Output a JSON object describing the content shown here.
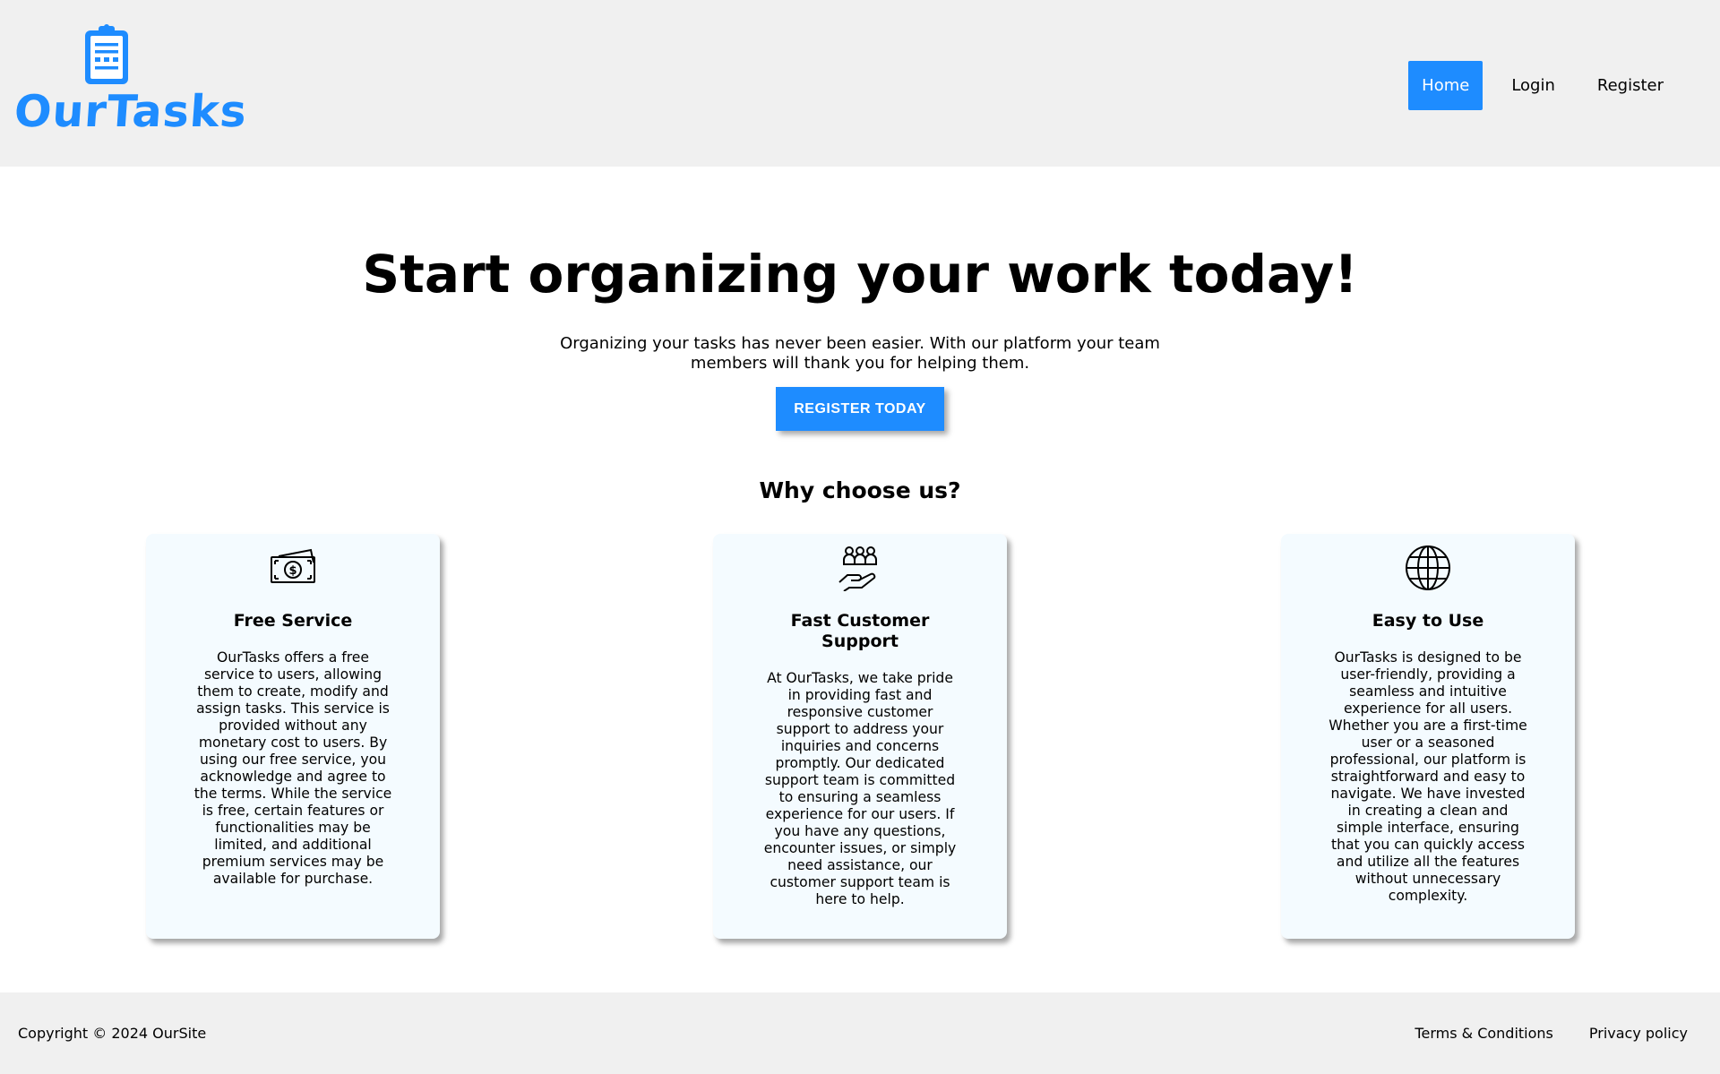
{
  "brand": {
    "name": "OurTasks",
    "color": "#1e8cff"
  },
  "nav": {
    "items": [
      {
        "label": "Home",
        "active": true
      },
      {
        "label": "Login",
        "active": false
      },
      {
        "label": "Register",
        "active": false
      }
    ]
  },
  "hero": {
    "title": "Start organizing your work today!",
    "description": "Organizing your tasks has never been easier. With our platform your team members will thank you for helping them.",
    "cta_label": "REGISTER TODAY"
  },
  "features": {
    "title": "Why choose us?",
    "cards": [
      {
        "icon": "money-icon",
        "title": "Free Service",
        "text": "OurTasks offers a free service to users, allowing them to create, modify and assign tasks. This service is provided without any monetary cost to users. By using our free service, you acknowledge and agree to the terms. While the service is free, certain features or functionalities may be limited, and additional premium services may be available for purchase."
      },
      {
        "icon": "support-hand-icon",
        "title": "Fast Customer Support",
        "text": "At OurTasks, we take pride in providing fast and responsive customer support to address your inquiries and concerns promptly. Our dedicated support team is committed to ensuring a seamless experience for our users. If you have any questions, encounter issues, or simply need assistance, our customer support team is here to help."
      },
      {
        "icon": "globe-icon",
        "title": "Easy to Use",
        "text": "OurTasks is designed to be user-friendly, providing a seamless and intuitive experience for all users. Whether you are a first-time user or a seasoned professional, our platform is straightforward and easy to navigate. We have invested in creating a clean and simple interface, ensuring that you can quickly access and utilize all the features without unnecessary complexity."
      }
    ]
  },
  "footer": {
    "copyright": "Copyright © 2024 OurSite",
    "links": [
      "Terms & Conditions",
      "Privacy policy"
    ]
  }
}
